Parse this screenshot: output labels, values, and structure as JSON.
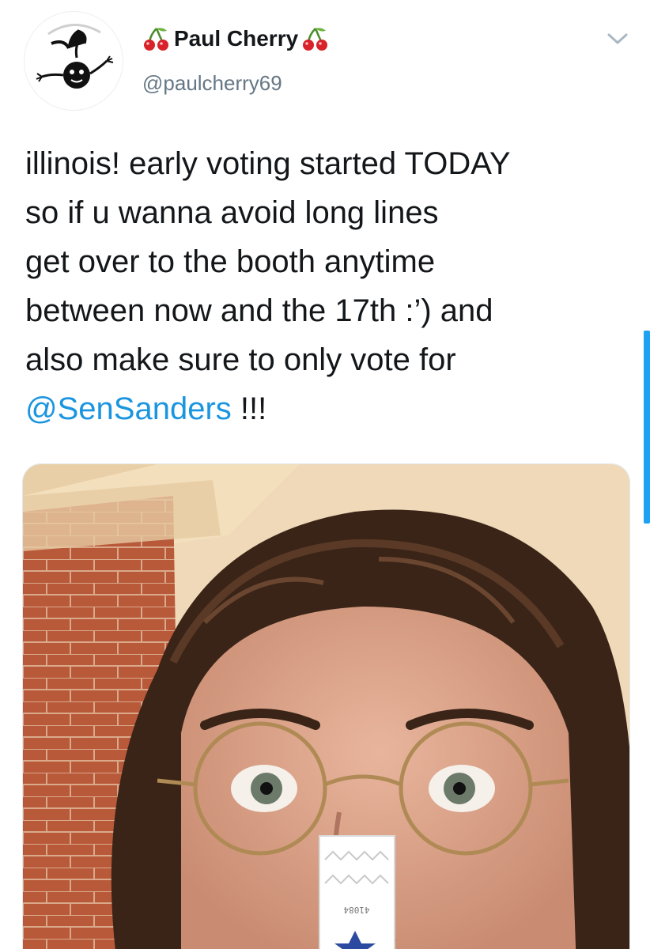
{
  "tweet": {
    "display_name": "Paul Cherry",
    "handle": "@paulcherry69",
    "text_lines": [
      "illinois! early voting started TODAY",
      "so if u wanna avoid long lines",
      "get over to the booth anytime",
      "between now and the 17th :’) and",
      "also make sure to only vote for"
    ],
    "mention": "@SenSanders",
    "mention_suffix": " !!!",
    "sticker_number": "41084"
  },
  "icons": {
    "name_left": "cherry-emoji-icon",
    "name_right": "cherry-emoji-icon",
    "menu": "chevron-down-icon",
    "avatar": "cherry-character-avatar"
  },
  "colors": {
    "text": "#14171a",
    "secondary": "#657786",
    "link": "#1b95e0",
    "accent": "#1da1f2"
  }
}
